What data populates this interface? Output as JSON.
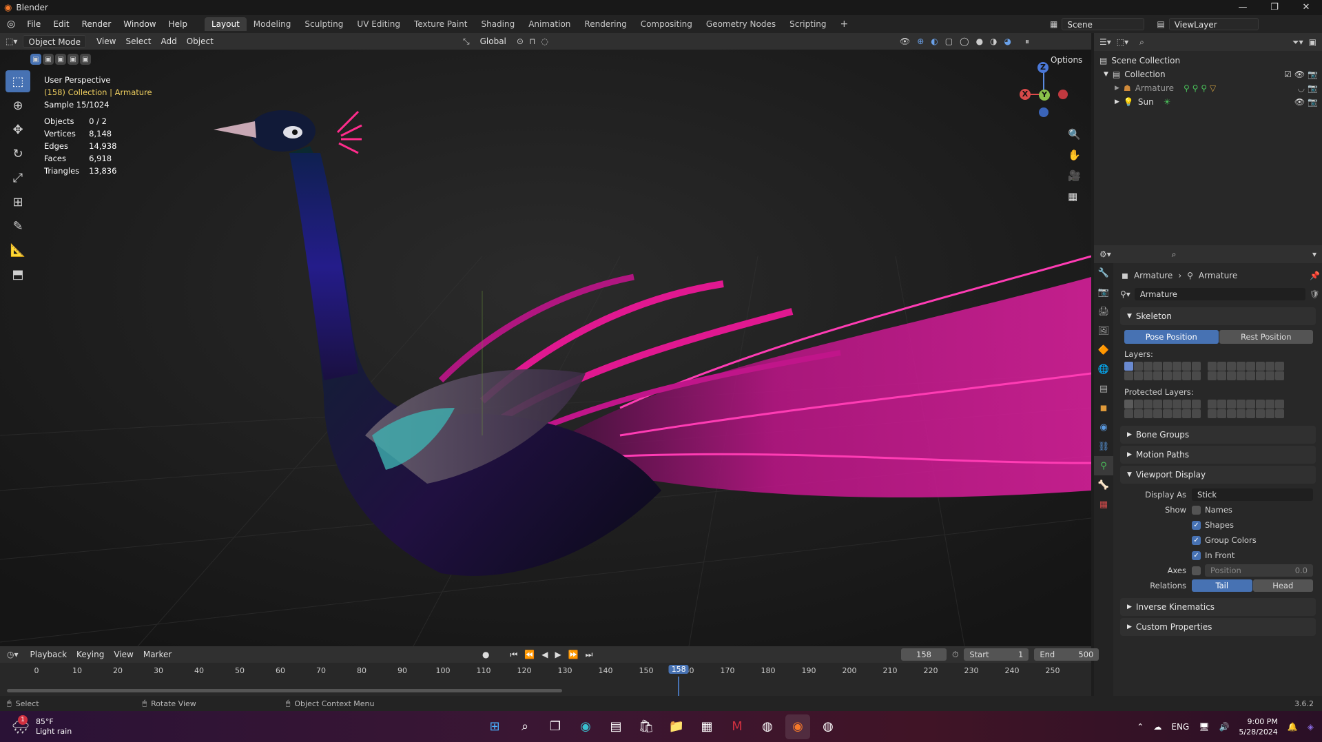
{
  "window": {
    "title": "Blender",
    "controls": [
      "—",
      "❐",
      "✕"
    ]
  },
  "menu": [
    "File",
    "Edit",
    "Render",
    "Window",
    "Help"
  ],
  "workspaces": [
    "Layout",
    "Modeling",
    "Sculpting",
    "UV Editing",
    "Texture Paint",
    "Shading",
    "Animation",
    "Rendering",
    "Compositing",
    "Geometry Nodes",
    "Scripting"
  ],
  "active_workspace": "Layout",
  "scene": {
    "name": "Scene",
    "view_layer": "ViewLayer"
  },
  "viewport_header": {
    "mode": "Object Mode",
    "menus": [
      "View",
      "Select",
      "Add",
      "Object"
    ],
    "orientation": "Global",
    "options": "Options"
  },
  "overlay_stats": {
    "view": "User Perspective",
    "collection_line": "(158) Collection | Armature",
    "sample": "Sample 15/1024",
    "rows": [
      {
        "label": "Objects",
        "value": "0 / 2"
      },
      {
        "label": "Vertices",
        "value": "8,148"
      },
      {
        "label": "Edges",
        "value": "14,938"
      },
      {
        "label": "Faces",
        "value": "6,918"
      },
      {
        "label": "Triangles",
        "value": "13,836"
      }
    ]
  },
  "gizmo": {
    "z": "Z",
    "x": "X",
    "y": "Y"
  },
  "outliner": {
    "root": "Scene Collection",
    "items": [
      {
        "name": "Collection",
        "level": 1
      },
      {
        "name": "Armature",
        "level": 2
      },
      {
        "name": "Sun",
        "level": 2
      }
    ]
  },
  "properties": {
    "breadcrumb": [
      "Armature",
      "Armature"
    ],
    "data_name": "Armature",
    "skeleton": {
      "title": "Skeleton",
      "pose_position": "Pose Position",
      "rest_position": "Rest Position",
      "layers_label": "Layers:",
      "protected_label": "Protected Layers:"
    },
    "collapsed_sections": [
      "Bone Groups",
      "Motion Paths"
    ],
    "viewport_display": {
      "title": "Viewport Display",
      "display_as_label": "Display As",
      "display_as_value": "Stick",
      "show_label": "Show",
      "show_options": [
        {
          "label": "Names",
          "checked": false
        },
        {
          "label": "Shapes",
          "checked": true
        },
        {
          "label": "Group Colors",
          "checked": true
        },
        {
          "label": "In Front",
          "checked": true
        }
      ],
      "axes_label": "Axes",
      "position_label": "Position",
      "position_value": "0.0",
      "relations_label": "Relations",
      "tail": "Tail",
      "head": "Head"
    },
    "bottom_sections": [
      "Inverse Kinematics",
      "Custom Properties"
    ]
  },
  "timeline": {
    "menus": [
      "Playback",
      "Keying",
      "View",
      "Marker"
    ],
    "current_frame": "158",
    "start_label": "Start",
    "start": "1",
    "end_label": "End",
    "end": "500",
    "ticks": [
      "0",
      "10",
      "20",
      "30",
      "40",
      "50",
      "60",
      "70",
      "80",
      "90",
      "100",
      "110",
      "120",
      "130",
      "140",
      "150",
      "160",
      "170",
      "180",
      "190",
      "200",
      "210",
      "220",
      "230",
      "240",
      "250"
    ],
    "playhead": "158"
  },
  "statusbar": {
    "hints": [
      "Select",
      "Rotate View",
      "Object Context Menu"
    ],
    "version": "3.6.2"
  },
  "taskbar": {
    "weather_temp": "85°F",
    "weather_desc": "Light rain",
    "weather_badge": "1",
    "lang": "ENG",
    "time": "9:00 PM",
    "date": "5/28/2024"
  },
  "colors": {
    "accent": "#4772b3",
    "tail_pink": "#e0189a",
    "body_blue": "#1e1a70"
  }
}
